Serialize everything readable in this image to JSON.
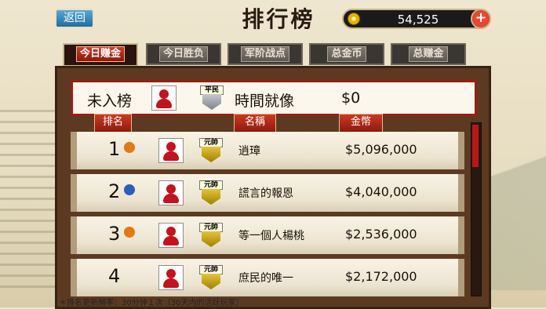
{
  "header": {
    "back_label": "返回",
    "title": "排行榜",
    "coins": "54,525",
    "plus_label": "+"
  },
  "tabs": [
    {
      "label": "今日赚金",
      "active": true
    },
    {
      "label": "今日胜负",
      "active": false
    },
    {
      "label": "军阶战点",
      "active": false
    },
    {
      "label": "总金币",
      "active": false
    },
    {
      "label": "总赚金",
      "active": false
    }
  ],
  "my_rank": {
    "status": "未入榜",
    "badge": "平民",
    "name": "時間就像",
    "money": "$0"
  },
  "columns": {
    "rank": "排名",
    "name": "名稱",
    "money": "金幣"
  },
  "rows": [
    {
      "rank": "1",
      "badge": "元帥",
      "name": "逍璋",
      "money": "$5,096,000",
      "medal_color": "#e07a12"
    },
    {
      "rank": "2",
      "badge": "元帥",
      "name": "謊言的報恩",
      "money": "$4,040,000",
      "medal_color": "#2c5db8"
    },
    {
      "rank": "3",
      "badge": "元帥",
      "name": "等一個人楊桃",
      "money": "$2,536,000",
      "medal_color": "#e07a12"
    },
    {
      "rank": "4",
      "badge": "元帥",
      "name": "庶民的唯一",
      "money": "$2,172,000",
      "medal_color": ""
    }
  ],
  "footer": "＊排名更新頻率：30分钟１次（30天内的活跃玩家）"
}
